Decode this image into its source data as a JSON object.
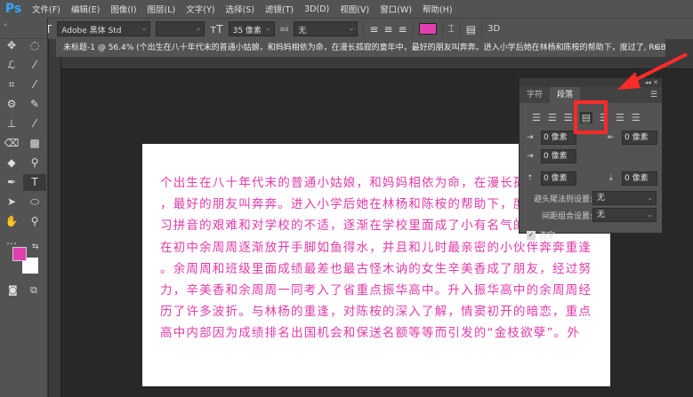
{
  "app": {
    "logo": "Ps"
  },
  "menu": [
    "文件(F)",
    "编辑(E)",
    "图像(I)",
    "图层(L)",
    "文字(Y)",
    "选择(S)",
    "滤镜(T)",
    "3D(D)",
    "视图(V)",
    "窗口(W)",
    "帮助(H)"
  ],
  "options": {
    "tool_glyph": "T",
    "font_family": "Adobe 黑体 Std",
    "font_style": "",
    "font_size": "35 像素",
    "aa_label": "aa",
    "antialias": "无",
    "color": "#e040b0",
    "threeD": "3D"
  },
  "tab": {
    "title": "未标题-1 @ 56.4% (个出生在八十年代末的普通小姑娘，和妈妈相依为命，在漫长孤寂的童年中，最好的朋友叫奔奔。进入小学后她在林杨和陈桉的帮助下，度过了, RGB...",
    "close": "×"
  },
  "colors": {
    "foreground": "#e040b0",
    "background": "#ffffff"
  },
  "document": {
    "lines": [
      "个出生在八十年代末的普通小姑娘，和妈妈相依为命，在漫长孤",
      "，最好的朋友叫奔奔。进入小学后她在林杨和陈桉的帮助下，度",
      "习拼音的艰难和对学校的不适，逐渐在学校里面成了小有名气的",
      "在初中余周周逐渐放开手脚如鱼得水，并且和儿时最亲密的小伙伴奔奔重逢",
      "。余周周和班级里面成绩最差也最古怪木讷的女生辛美香成了朋友，经过努",
      "力，辛美香和余周周一同考入了省重点振华高中。升入振华高中的余周周经",
      "历了许多波折。与林杨的重逢，对陈桉的深入了解，情窦初开的暗恋，重点",
      "高中内部因为成绩排名出国机会和保送名额等等而引发的“金枝欲孽”。外"
    ]
  },
  "panel": {
    "tabs": [
      "字符",
      "段落"
    ],
    "indent_left": "0 像素",
    "indent_right": "0 像素",
    "indent_first": "0 像素",
    "space_before": "0 像素",
    "space_after": "0 像素",
    "kinsoku_label": "避头尾法则设置:",
    "kinsoku_value": "无",
    "mojikumi_label": "间距组合设置:",
    "mojikumi_value": "无",
    "hyphenate_label": "连字",
    "hyphenate_checked": true
  }
}
